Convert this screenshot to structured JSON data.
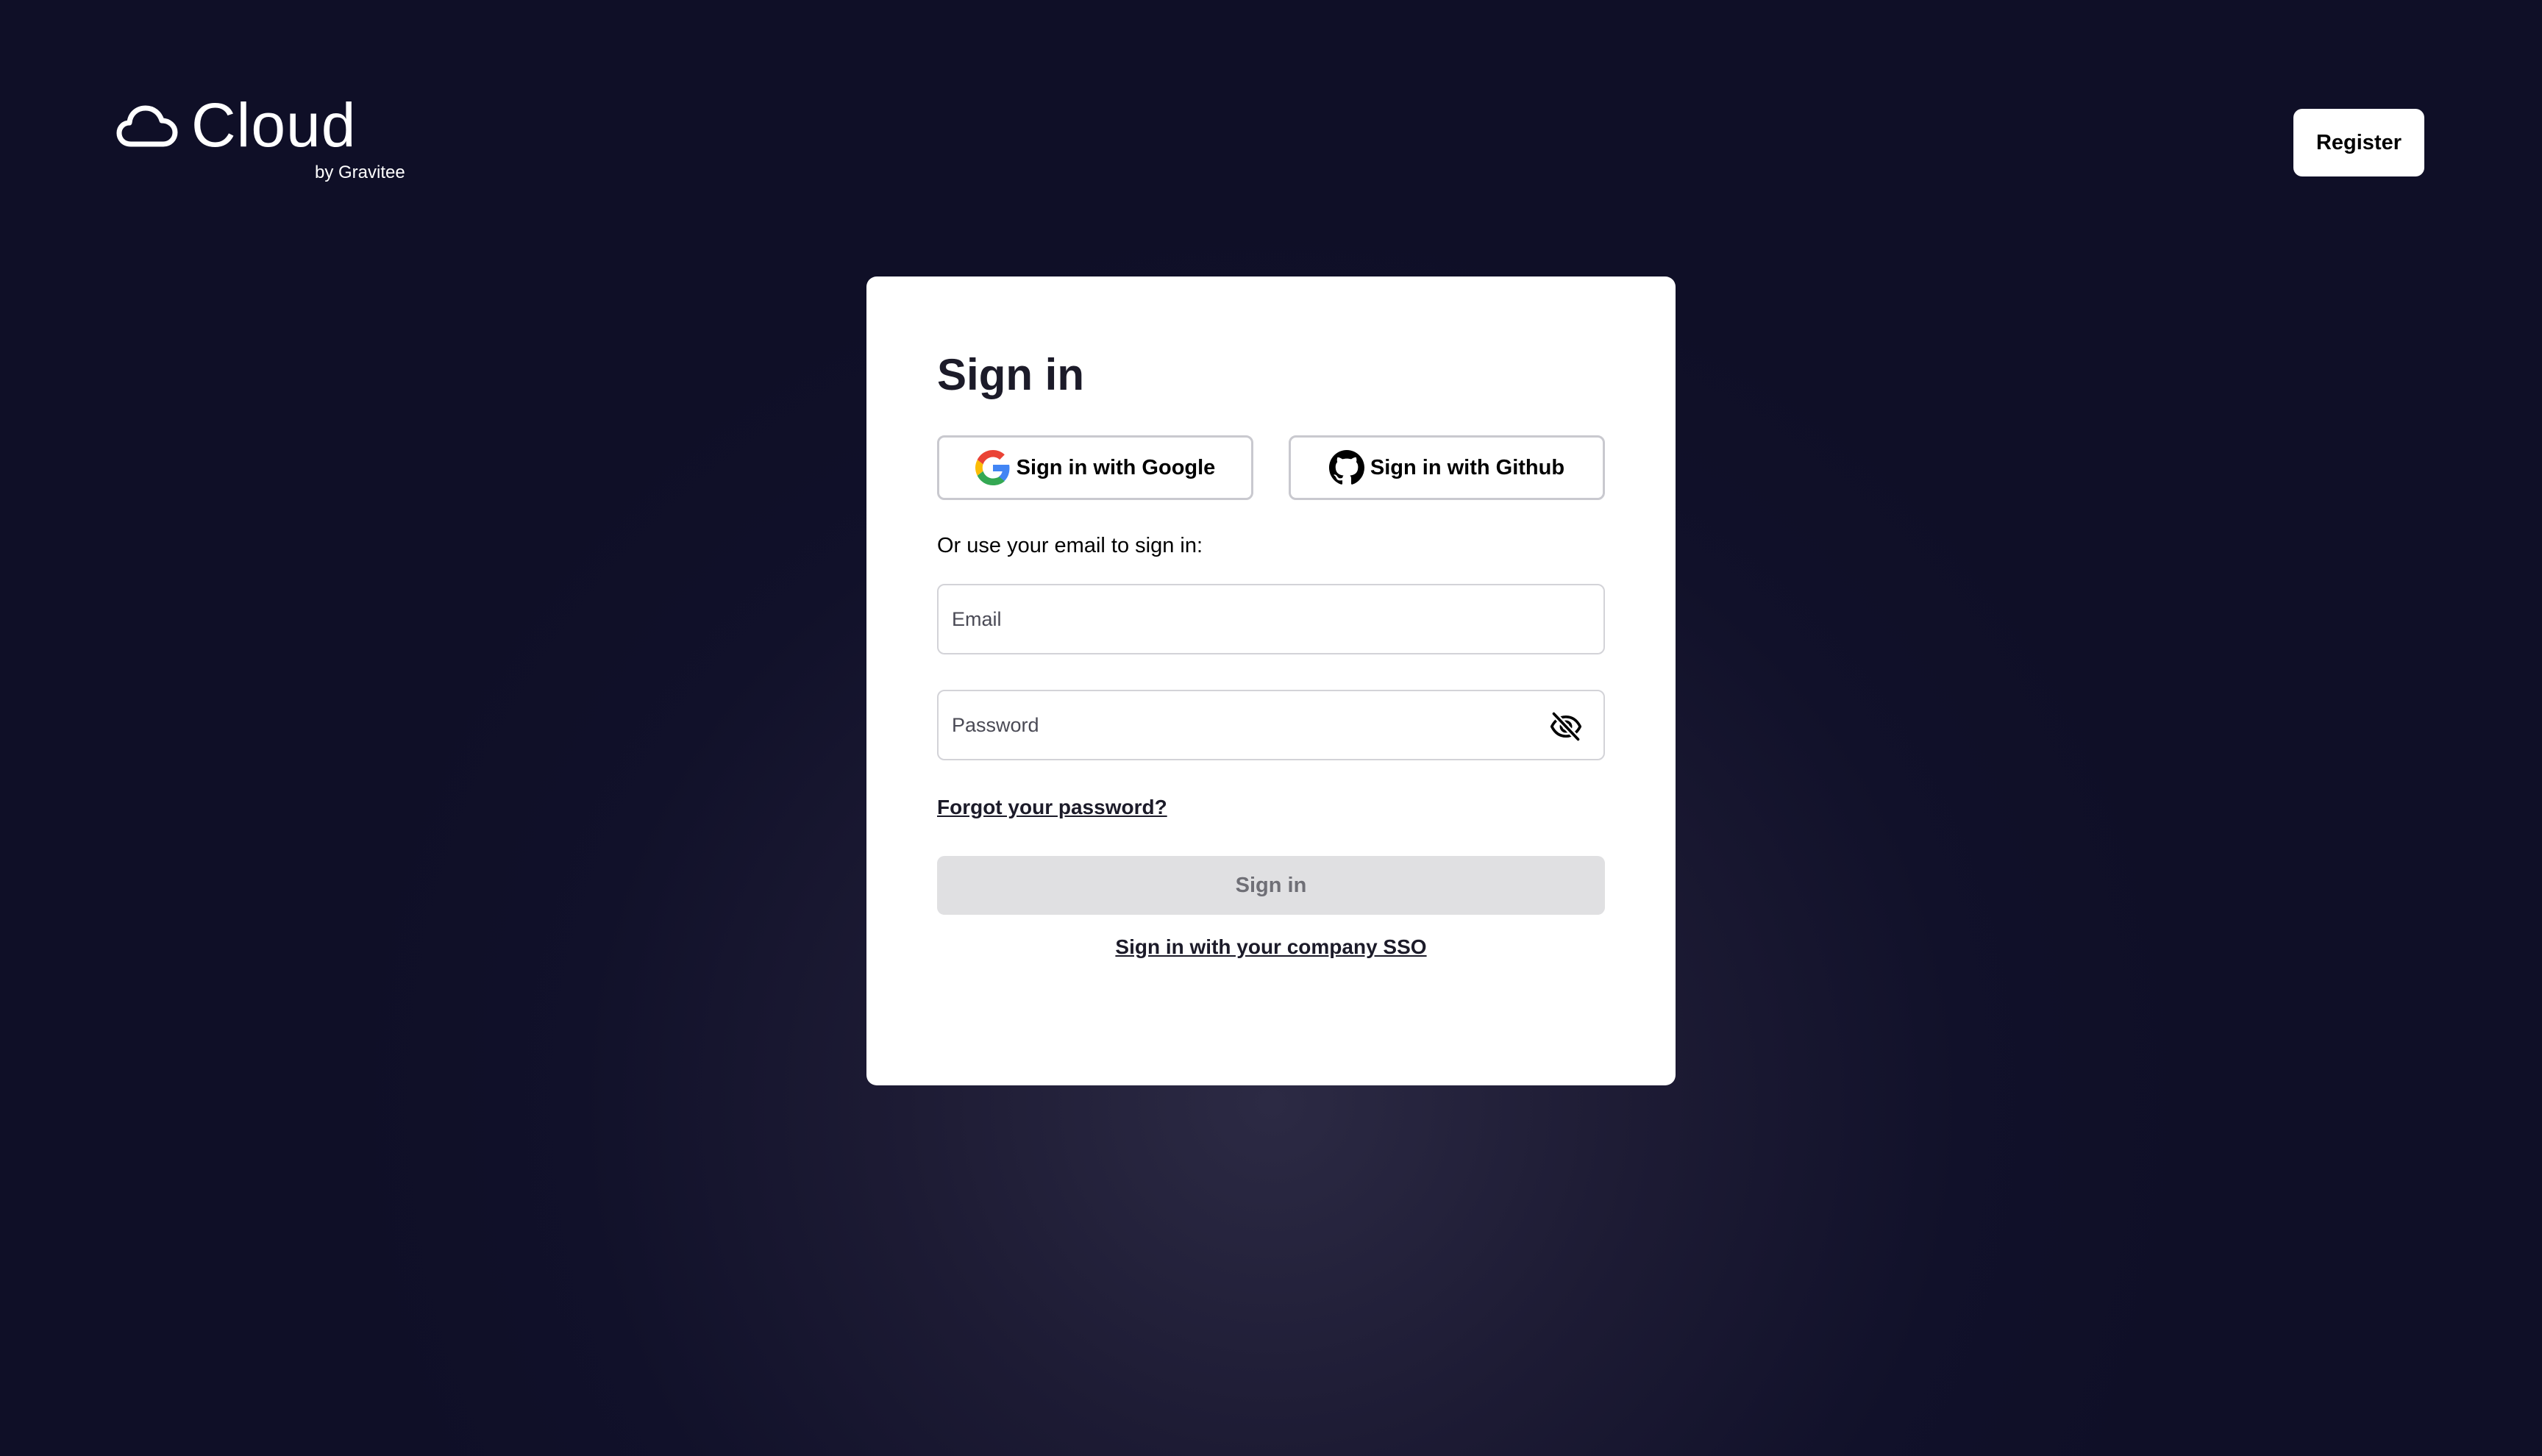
{
  "brand": {
    "name": "Cloud",
    "tagline": "by Gravitee",
    "logo_icon": "cloud-icon"
  },
  "header": {
    "register_label": "Register"
  },
  "signin_card": {
    "title": "Sign in",
    "google_label": "Sign in with Google",
    "google_icon": "google-icon",
    "github_label": "Sign in with Github",
    "github_icon": "github-icon",
    "email_prompt": "Or use your email to sign in:",
    "email": {
      "placeholder": "Email",
      "value": ""
    },
    "password": {
      "placeholder": "Password",
      "value": "",
      "toggle_icon": "eye-off-icon"
    },
    "forgot_password_label": "Forgot your password?",
    "submit_label": "Sign in",
    "submit_disabled": true,
    "sso_label": "Sign in with your company SSO"
  },
  "colors": {
    "background": "#0f0f27",
    "card": "#ffffff",
    "text": "#1c1b29",
    "disabled_button": "#e0e0e2",
    "disabled_text": "#6f6f76"
  }
}
